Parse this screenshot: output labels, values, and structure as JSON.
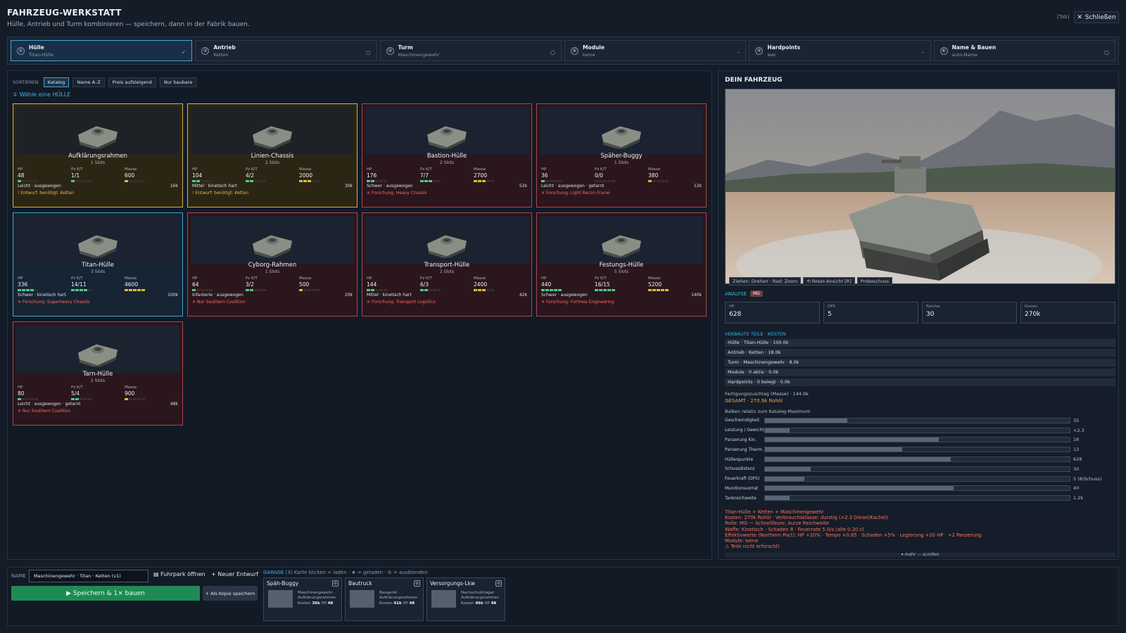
{
  "header": {
    "title": "FAHRZEUG-WERKSTATT",
    "subtitle": "Hülle, Antrieb und Turm kombinieren — speichern, dann in der Fabrik bauen.",
    "tab_hint": "[Tab]",
    "close_label": "Schließen"
  },
  "steps": [
    {
      "num": "①",
      "title": "Hülle",
      "sub": "Titan-Hülle",
      "mark": "✓",
      "active": true
    },
    {
      "num": "②",
      "title": "Antrieb",
      "sub": "Ketten",
      "mark": "○"
    },
    {
      "num": "③",
      "title": "Turm",
      "sub": "Maschinengewehr",
      "mark": "○"
    },
    {
      "num": "④",
      "title": "Module",
      "sub": "keine",
      "mark": "–"
    },
    {
      "num": "⑤",
      "title": "Hardpoints",
      "sub": "leer",
      "mark": "–"
    },
    {
      "num": "⑥",
      "title": "Name & Bauen",
      "sub": "auto-Name",
      "mark": "○"
    }
  ],
  "sort": {
    "label": "SORTIEREN",
    "options": [
      "Katalog",
      "Name A–Z",
      "Preis aufsteigend",
      "Nur baubare"
    ],
    "active": 0
  },
  "choose_label": "① Wähle eine HÜLLE",
  "stat_labels": {
    "hp": "HP",
    "pz": "Pz K/T",
    "mass": "Masse"
  },
  "hulls": [
    {
      "name": "Aufklärungsrahmen",
      "slots": "1 Slots",
      "hp": "48",
      "pz": "1/1",
      "mass": "600",
      "tags": "Leicht · ausgewogen",
      "cost": "16k",
      "req": "! Entwurf: benötigt: Ketten",
      "state": "warn",
      "p": [
        1,
        1,
        1
      ]
    },
    {
      "name": "Linien-Chassis",
      "slots": "2 Slots",
      "hp": "104",
      "pz": "4/2",
      "mass": "2000",
      "tags": "Mittel · kinetisch hart",
      "cost": "30k",
      "req": "! Entwurf: benötigt: Ketten",
      "state": "warn",
      "p": [
        2,
        2,
        3
      ]
    },
    {
      "name": "Bastion-Hülle",
      "slots": "2 Slots",
      "hp": "176",
      "pz": "7/7",
      "mass": "2700",
      "tags": "Schwer · ausgewogen",
      "cost": "52k",
      "req": "✕ Forschung: Heavy Chassis",
      "state": "locked",
      "p": [
        2,
        3,
        3
      ]
    },
    {
      "name": "Späher-Buggy",
      "slots": "1 Slots",
      "hp": "36",
      "pz": "0/0",
      "mass": "380",
      "tags": "Leicht · ausgewogen · getarnt",
      "cost": "12k",
      "req": "✕ Forschung: Light Recon Frame",
      "state": "locked",
      "p": [
        1,
        0,
        1
      ]
    },
    {
      "name": "Titan-Hülle",
      "slots": "3 Slots",
      "hp": "336",
      "pz": "14/11",
      "mass": "4600",
      "tags": "Schwer · kinetisch hart",
      "cost": "100k",
      "req": "✕ Forschung: Superheavy Chassis",
      "state": "sel",
      "p": [
        4,
        4,
        5
      ]
    },
    {
      "name": "Cyborg-Rahmen",
      "slots": "1 Slots",
      "hp": "64",
      "pz": "3/2",
      "mass": "500",
      "tags": "Infanterie · ausgewogen",
      "cost": "20k",
      "req": "✕ Nur Southern Coalition",
      "state": "locked",
      "p": [
        1,
        2,
        1
      ]
    },
    {
      "name": "Transport-Hülle",
      "slots": "2 Slots",
      "hp": "144",
      "pz": "6/3",
      "mass": "2400",
      "tags": "Mittel · kinetisch hart",
      "cost": "42k",
      "req": "✕ Forschung: Transport Logistics",
      "state": "locked",
      "p": [
        2,
        2,
        3
      ]
    },
    {
      "name": "Festungs-Hülle",
      "slots": "5 Slots",
      "hp": "440",
      "pz": "16/15",
      "mass": "5200",
      "tags": "Schwer · ausgewogen",
      "cost": "140k",
      "req": "✕ Forschung: Fortress Engineering",
      "state": "locked",
      "p": [
        5,
        5,
        5
      ]
    },
    {
      "name": "Tarn-Hülle",
      "slots": "2 Slots",
      "hp": "80",
      "pz": "5/4",
      "mass": "900",
      "tags": "Leicht · ausgewogen · getarnt",
      "cost": "48k",
      "req": "✕ Nur Southern Coalition",
      "state": "locked",
      "p": [
        1,
        2,
        1
      ]
    }
  ],
  "preview": {
    "title": "DEIN FAHRZEUG",
    "hint": "Ziehen: Drehen · Rad: Zoom",
    "reset": "⟲ Reset-Ansicht [R]",
    "test": "Probeschuss"
  },
  "analysis": {
    "label": "ANALYSE",
    "badge": "MG",
    "boxes": [
      {
        "k": "HP",
        "v": "628"
      },
      {
        "k": "DPS",
        "v": "5"
      },
      {
        "k": "Reichw.",
        "v": "30"
      },
      {
        "k": "Kosten",
        "v": "270k"
      }
    ],
    "parts_header": "VERBAUTE TEILE · KOSTEN",
    "parts": [
      "Hülle · Titan-Hülle · 100.0k",
      "Antrieb · Ketten · 18.0k",
      "Turm · Maschinengewehr · 8.0k",
      "Module · 0 aktiv · 0.0k",
      "Hardpoints · 0 belegt · 0.0k"
    ],
    "fert": "Fertigungszuschlag (Masse) · 144.9k",
    "total": "GESAMT · 270.9k Rohöl",
    "bars_header": "Balken relativ zum Katalog-Maximum",
    "bars": [
      {
        "k": "Geschwindigkeit",
        "v": "35",
        "f": 0.27
      },
      {
        "k": "Leistung / Gewicht",
        "v": "×2.3",
        "f": 0.08
      },
      {
        "k": "Panzerung Kin.",
        "v": "16",
        "f": 0.57
      },
      {
        "k": "Panzerung Therm.",
        "v": "13",
        "f": 0.45
      },
      {
        "k": "Hüllenpunkte",
        "v": "628",
        "f": 0.61
      },
      {
        "k": "Schussdistanz",
        "v": "30",
        "f": 0.15
      },
      {
        "k": "Feuerkraft (DPS)",
        "v": "5 (8/Schuss)",
        "f": 0.13
      },
      {
        "k": "Munitionsvorrat",
        "v": "40",
        "f": 0.62
      },
      {
        "k": "Tankreichweite",
        "v": "1.2k",
        "f": 0.08
      }
    ],
    "summary": [
      "Titan-Hülle + Ketten + Maschinengewehr",
      "Kosten: 270k Rohöl · Verbrauchsklasse: durstig (×2.3 Diesel/Kachel)",
      "Rolle: MG — Schnellfeuer, kurze Reichweite",
      "Waffe: Kinetisch · Schaden 8 · Feuerrate 5.0/s (alle 0.20 s)",
      "Effektivwerte (Northern Pact): HP +20% · Tempo ×0.85 · Schaden +5% · Legierung +20 HP · +2 Panzerung",
      "Module: keine",
      "⚠ Teile nicht erforscht!"
    ],
    "more": "▾ mehr — scrollen"
  },
  "bottom": {
    "name_label": "NAME",
    "name_value": "Maschinengewehr · Titan · Ketten (v1)",
    "fuhrpark": "▤ Fuhrpark öffnen",
    "neu": "+ Neuer Entwurf",
    "save": "▶ Speichern & 1× bauen",
    "copy": "+ Als Kopie speichern",
    "garage_header": "GARAGE (3)",
    "garage_hint": "Karte klicken = laden · ★ = geladen · ⊘ = ausblenden",
    "garage": [
      {
        "name": "Späh-Buggy",
        "d1": "Maschinengewehr ·",
        "d2": "Aufklärungsrahmen",
        "cost": "36k",
        "hp": "48"
      },
      {
        "name": "Bautruck",
        "d1": "Baugerät ·",
        "d2": "Aufklärungsrahmen",
        "cost": "41k",
        "hp": "48"
      },
      {
        "name": "Versorgungs-Lkw",
        "d1": "Nachschubträger ·",
        "d2": "Aufklärungsrahmen",
        "cost": "46k",
        "hp": "48"
      }
    ],
    "cost_label": "Kosten",
    "hp_label": "HP"
  }
}
